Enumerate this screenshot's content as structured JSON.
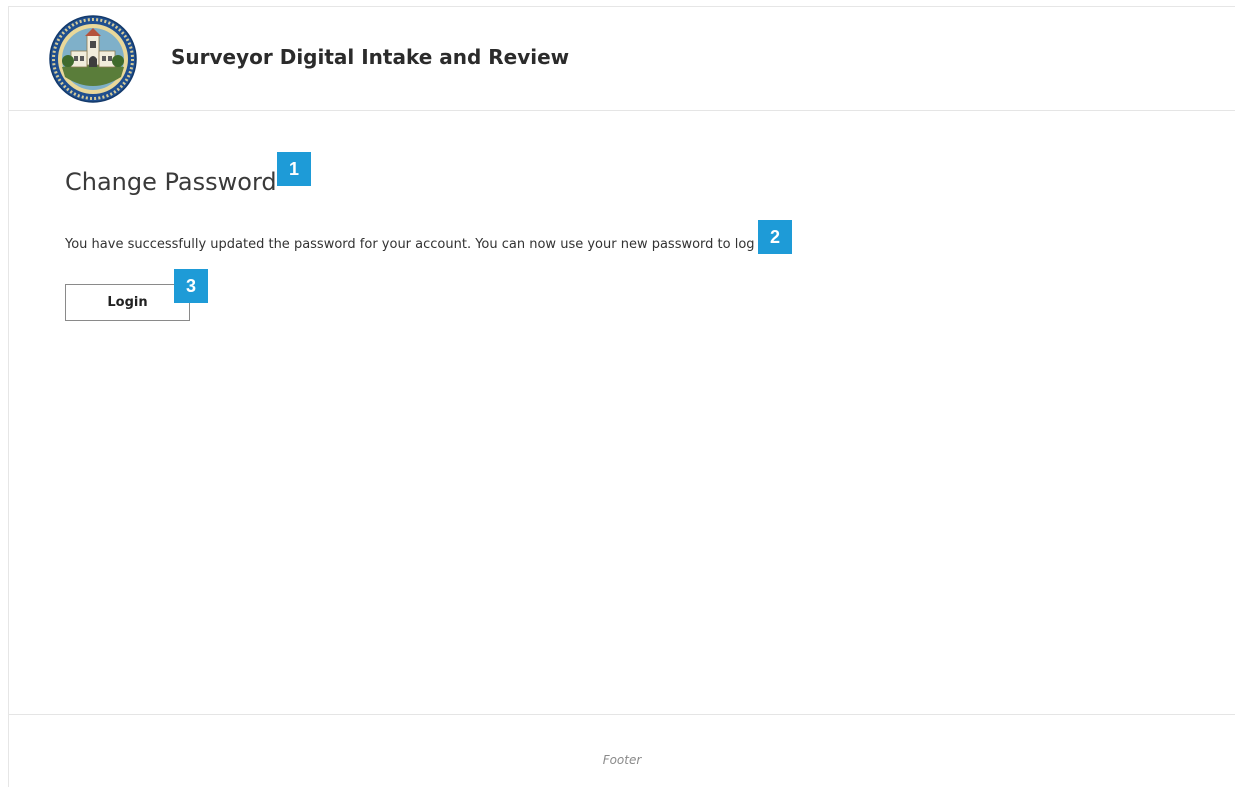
{
  "header": {
    "app_title": "Surveyor Digital Intake and Review",
    "seal": {
      "icon": "county-seal-logo",
      "text_top": "COUNTY OF SANTA BARBARA",
      "text_bottom": "CALIFORNIA",
      "colors": {
        "ring": "#1f4f8f",
        "ring_inner": "#e9d89a",
        "sky": "#7fb0c9",
        "building": "#f1eddc",
        "ground": "#5a7d3a"
      }
    }
  },
  "main": {
    "page_title": "Change Password",
    "message": "You have successfully updated the password for your account. You can now use your new password to log",
    "login_button_label": "Login"
  },
  "markers": [
    "1",
    "2",
    "3"
  ],
  "marker_color": "#1e9bd7",
  "footer": {
    "text": "Footer"
  }
}
